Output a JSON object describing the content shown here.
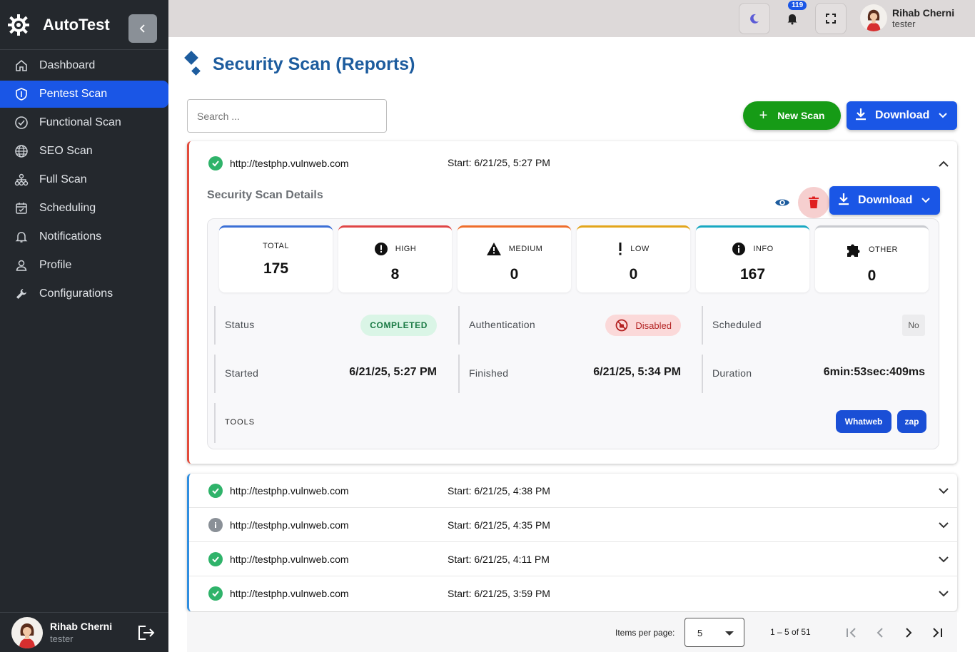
{
  "app": {
    "name": "AutoTest"
  },
  "sidebar": {
    "items": [
      {
        "label": "Dashboard",
        "icon": "home-icon"
      },
      {
        "label": "Pentest Scan",
        "icon": "shield-icon",
        "active": true
      },
      {
        "label": "Functional Scan",
        "icon": "check-circle-icon"
      },
      {
        "label": "SEO Scan",
        "icon": "globe-icon"
      },
      {
        "label": "Full Scan",
        "icon": "sitemap-icon"
      },
      {
        "label": "Scheduling",
        "icon": "calendar-icon"
      },
      {
        "label": "Notifications",
        "icon": "bell-icon"
      },
      {
        "label": "Profile",
        "icon": "user-icon"
      },
      {
        "label": "Configurations",
        "icon": "wrench-icon"
      }
    ],
    "user": {
      "name": "Rihab Cherni",
      "role": "tester"
    }
  },
  "topbar": {
    "notifications_count": "119",
    "user": {
      "name": "Rihab Cherni",
      "role": "tester"
    }
  },
  "page": {
    "title": "Security Scan (Reports)",
    "search_placeholder": "Search ...",
    "new_scan_label": "New Scan",
    "download_label": "Download"
  },
  "expanded_scan": {
    "url": "http://testphp.vulnweb.com",
    "start": "Start: 6/21/25, 5:27 PM",
    "details_title": "Security Scan Details",
    "download_label": "Download",
    "counts": [
      {
        "label": "TOTAL",
        "value": "175",
        "color": "#3b6fd6"
      },
      {
        "label": "HIGH",
        "value": "8",
        "color": "#e04545"
      },
      {
        "label": "MEDIUM",
        "value": "0",
        "color": "#ef6d2a"
      },
      {
        "label": "LOW",
        "value": "0",
        "color": "#e3a51a"
      },
      {
        "label": "INFO",
        "value": "167",
        "color": "#18a8c2"
      },
      {
        "label": "OTHER",
        "value": "0",
        "color": "#c9cbd0"
      }
    ],
    "status_label": "Status",
    "status_value": "COMPLETED",
    "auth_label": "Authentication",
    "auth_value": "Disabled",
    "scheduled_label": "Scheduled",
    "scheduled_value": "No",
    "started_label": "Started",
    "started_value": "6/21/25, 5:27 PM",
    "finished_label": "Finished",
    "finished_value": "6/21/25, 5:34 PM",
    "duration_label": "Duration",
    "duration_value": "6min:53sec:409ms",
    "tools_label": "TOOLS",
    "tools": [
      "Whatweb",
      "zap"
    ]
  },
  "scans": [
    {
      "url": "http://testphp.vulnweb.com",
      "start": "Start: 6/21/25, 4:38 PM",
      "status": "success"
    },
    {
      "url": "http://testphp.vulnweb.com",
      "start": "Start: 6/21/25, 4:35 PM",
      "status": "info"
    },
    {
      "url": "http://testphp.vulnweb.com",
      "start": "Start: 6/21/25, 4:11 PM",
      "status": "success"
    },
    {
      "url": "http://testphp.vulnweb.com",
      "start": "Start: 6/21/25, 3:59 PM",
      "status": "success"
    }
  ],
  "paginator": {
    "items_per_page_label": "Items per page:",
    "page_size": "5",
    "range": "1 – 5 of 51"
  }
}
